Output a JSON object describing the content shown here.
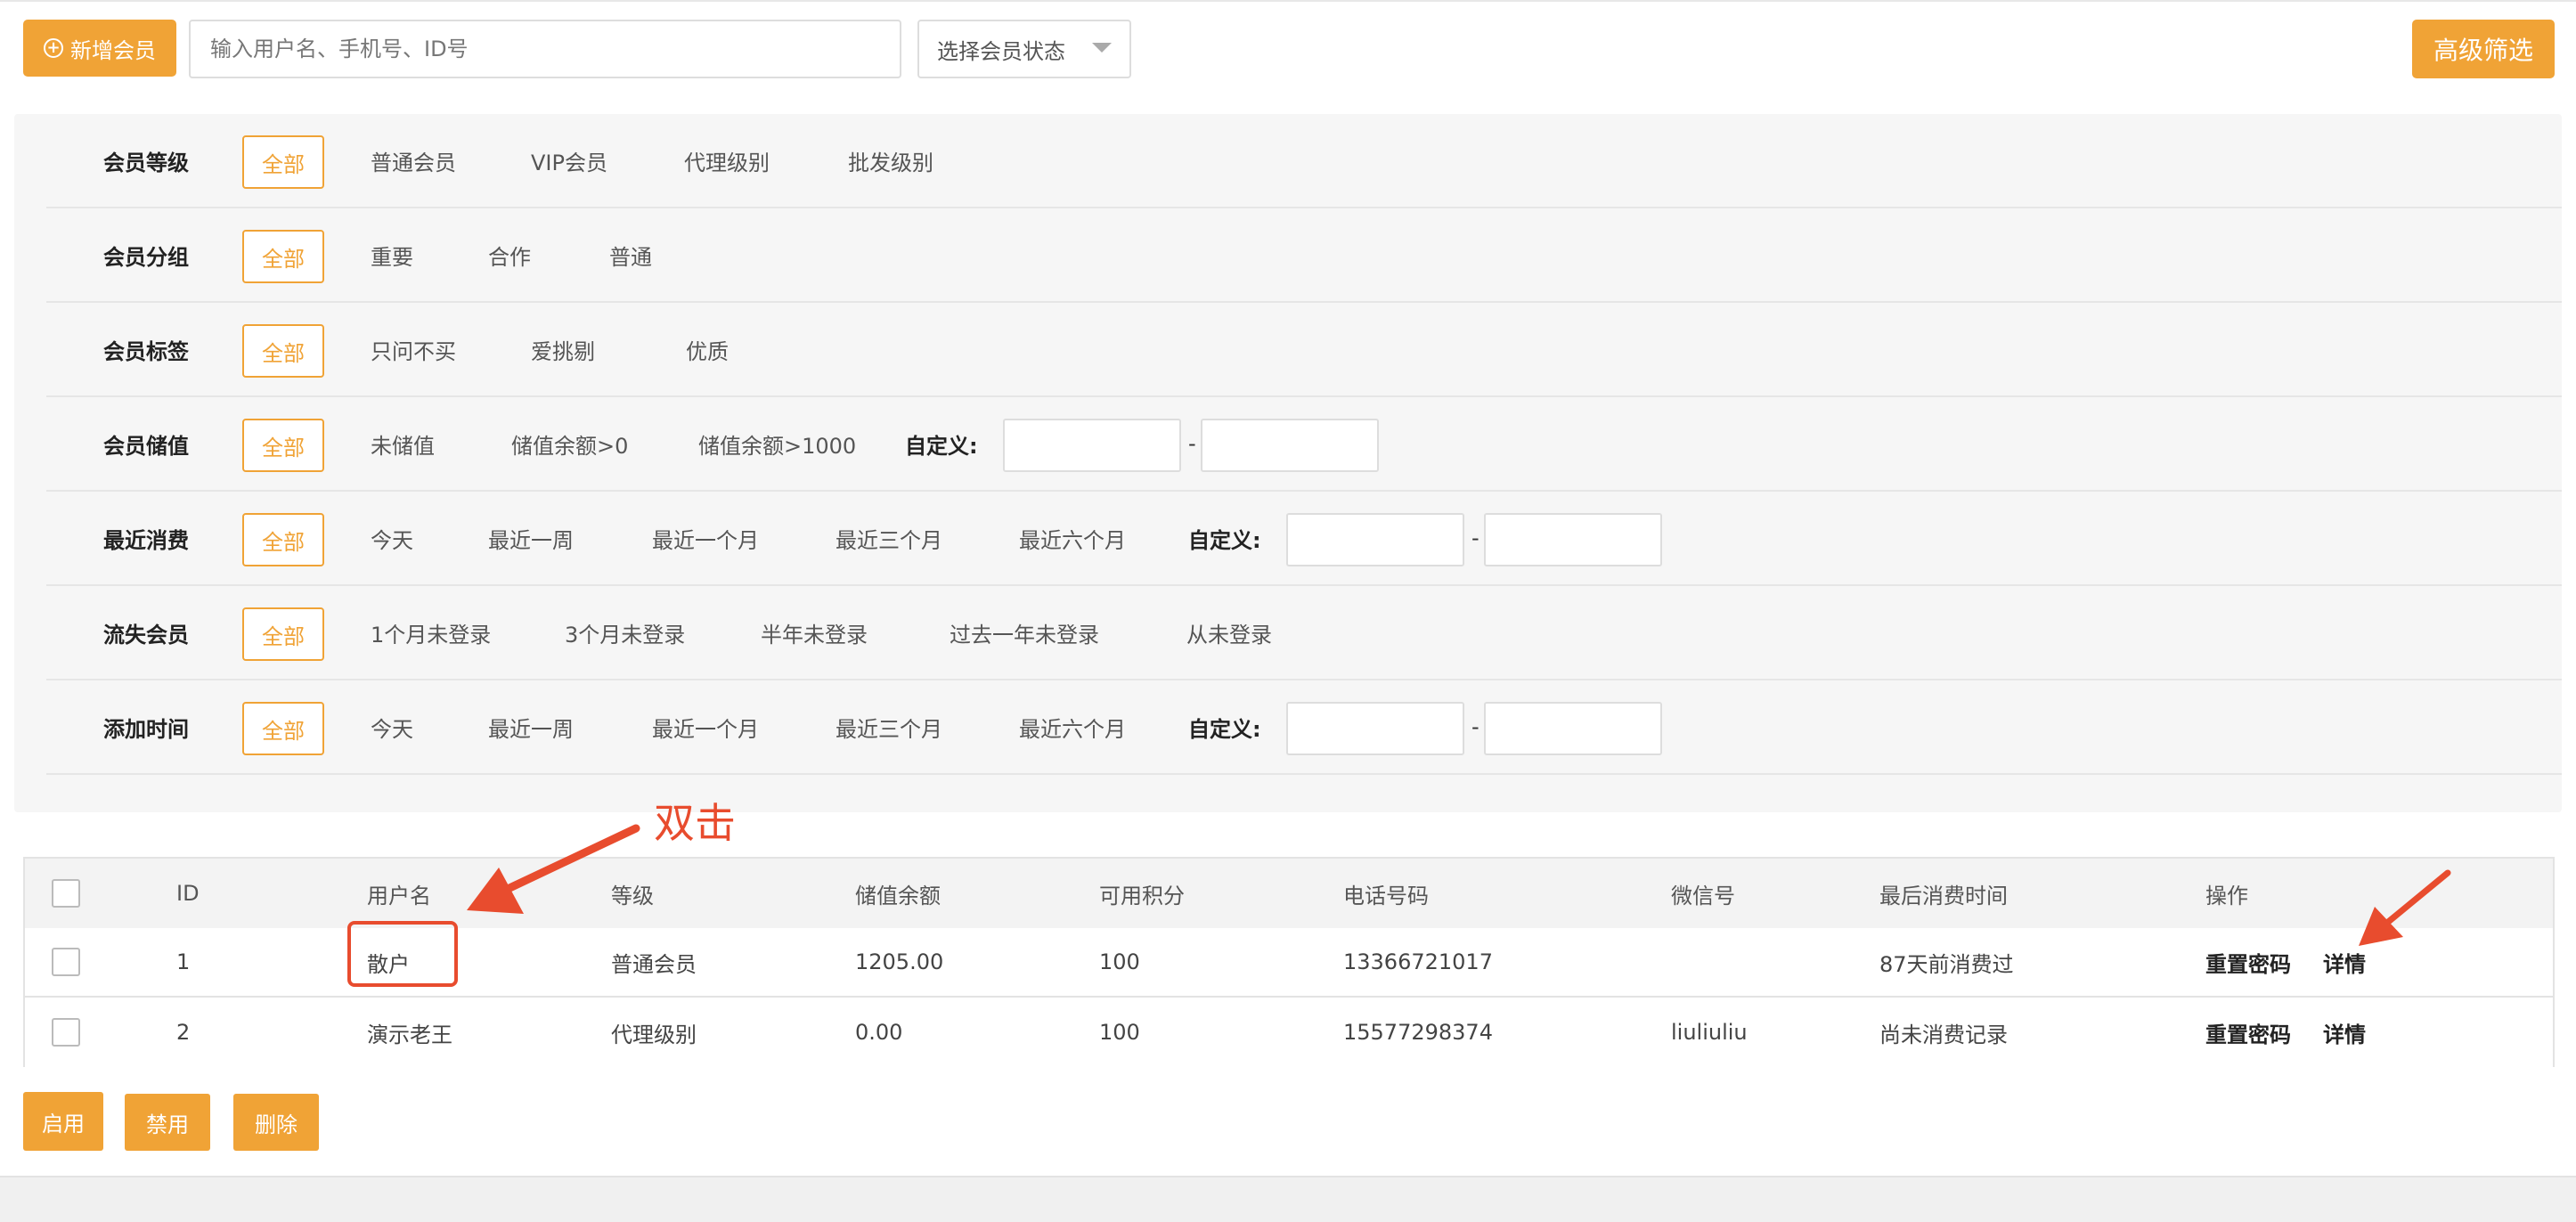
{
  "toolbar": {
    "add_member_label": "新增会员",
    "search_placeholder": "输入用户名、手机号、ID号",
    "status_select_label": "选择会员状态",
    "advanced_filter_label": "高级筛选"
  },
  "filters": [
    {
      "label": "会员等级",
      "active": "全部",
      "options": [
        "普通会员",
        "VIP会员",
        "代理级别",
        "批发级别"
      ]
    },
    {
      "label": "会员分组",
      "active": "全部",
      "options": [
        "重要",
        "合作",
        "普通"
      ]
    },
    {
      "label": "会员标签",
      "active": "全部",
      "options": [
        "只问不买",
        "爱挑剔",
        "优质"
      ]
    },
    {
      "label": "会员储值",
      "active": "全部",
      "options": [
        "未储值",
        "储值余额>0",
        "储值余额>1000"
      ],
      "custom_label": "自定义:"
    },
    {
      "label": "最近消费",
      "active": "全部",
      "options": [
        "今天",
        "最近一周",
        "最近一个月",
        "最近三个月",
        "最近六个月"
      ],
      "custom_label": "自定义:"
    },
    {
      "label": "流失会员",
      "active": "全部",
      "options": [
        "1个月未登录",
        "3个月未登录",
        "半年未登录",
        "过去一年未登录",
        "从未登录"
      ]
    },
    {
      "label": "添加时间",
      "active": "全部",
      "options": [
        "今天",
        "最近一周",
        "最近一个月",
        "最近三个月",
        "最近六个月"
      ],
      "custom_label": "自定义:"
    }
  ],
  "range_separator": "-",
  "table": {
    "headers": [
      "ID",
      "用户名",
      "等级",
      "储值余额",
      "可用积分",
      "电话号码",
      "微信号",
      "最后消费时间",
      "操作"
    ],
    "rows": [
      {
        "id": "1",
        "username": "散户",
        "level": "普通会员",
        "balance": "1205.00",
        "points": "100",
        "phone": "13366721017",
        "wechat": "",
        "last_consume": "87天前消费过"
      },
      {
        "id": "2",
        "username": "演示老王",
        "level": "代理级别",
        "balance": "0.00",
        "points": "100",
        "phone": "15577298374",
        "wechat": "liuliuliu",
        "last_consume": "尚未消费记录"
      }
    ],
    "actions": {
      "reset_password": "重置密码",
      "detail": "详情"
    }
  },
  "bulk_actions": {
    "enable": "启用",
    "disable": "禁用",
    "delete": "删除"
  },
  "annotation": {
    "text": "双击",
    "color": "#e84c2e"
  },
  "colors": {
    "accent": "#f0a336",
    "annotation": "#e84c2e"
  }
}
